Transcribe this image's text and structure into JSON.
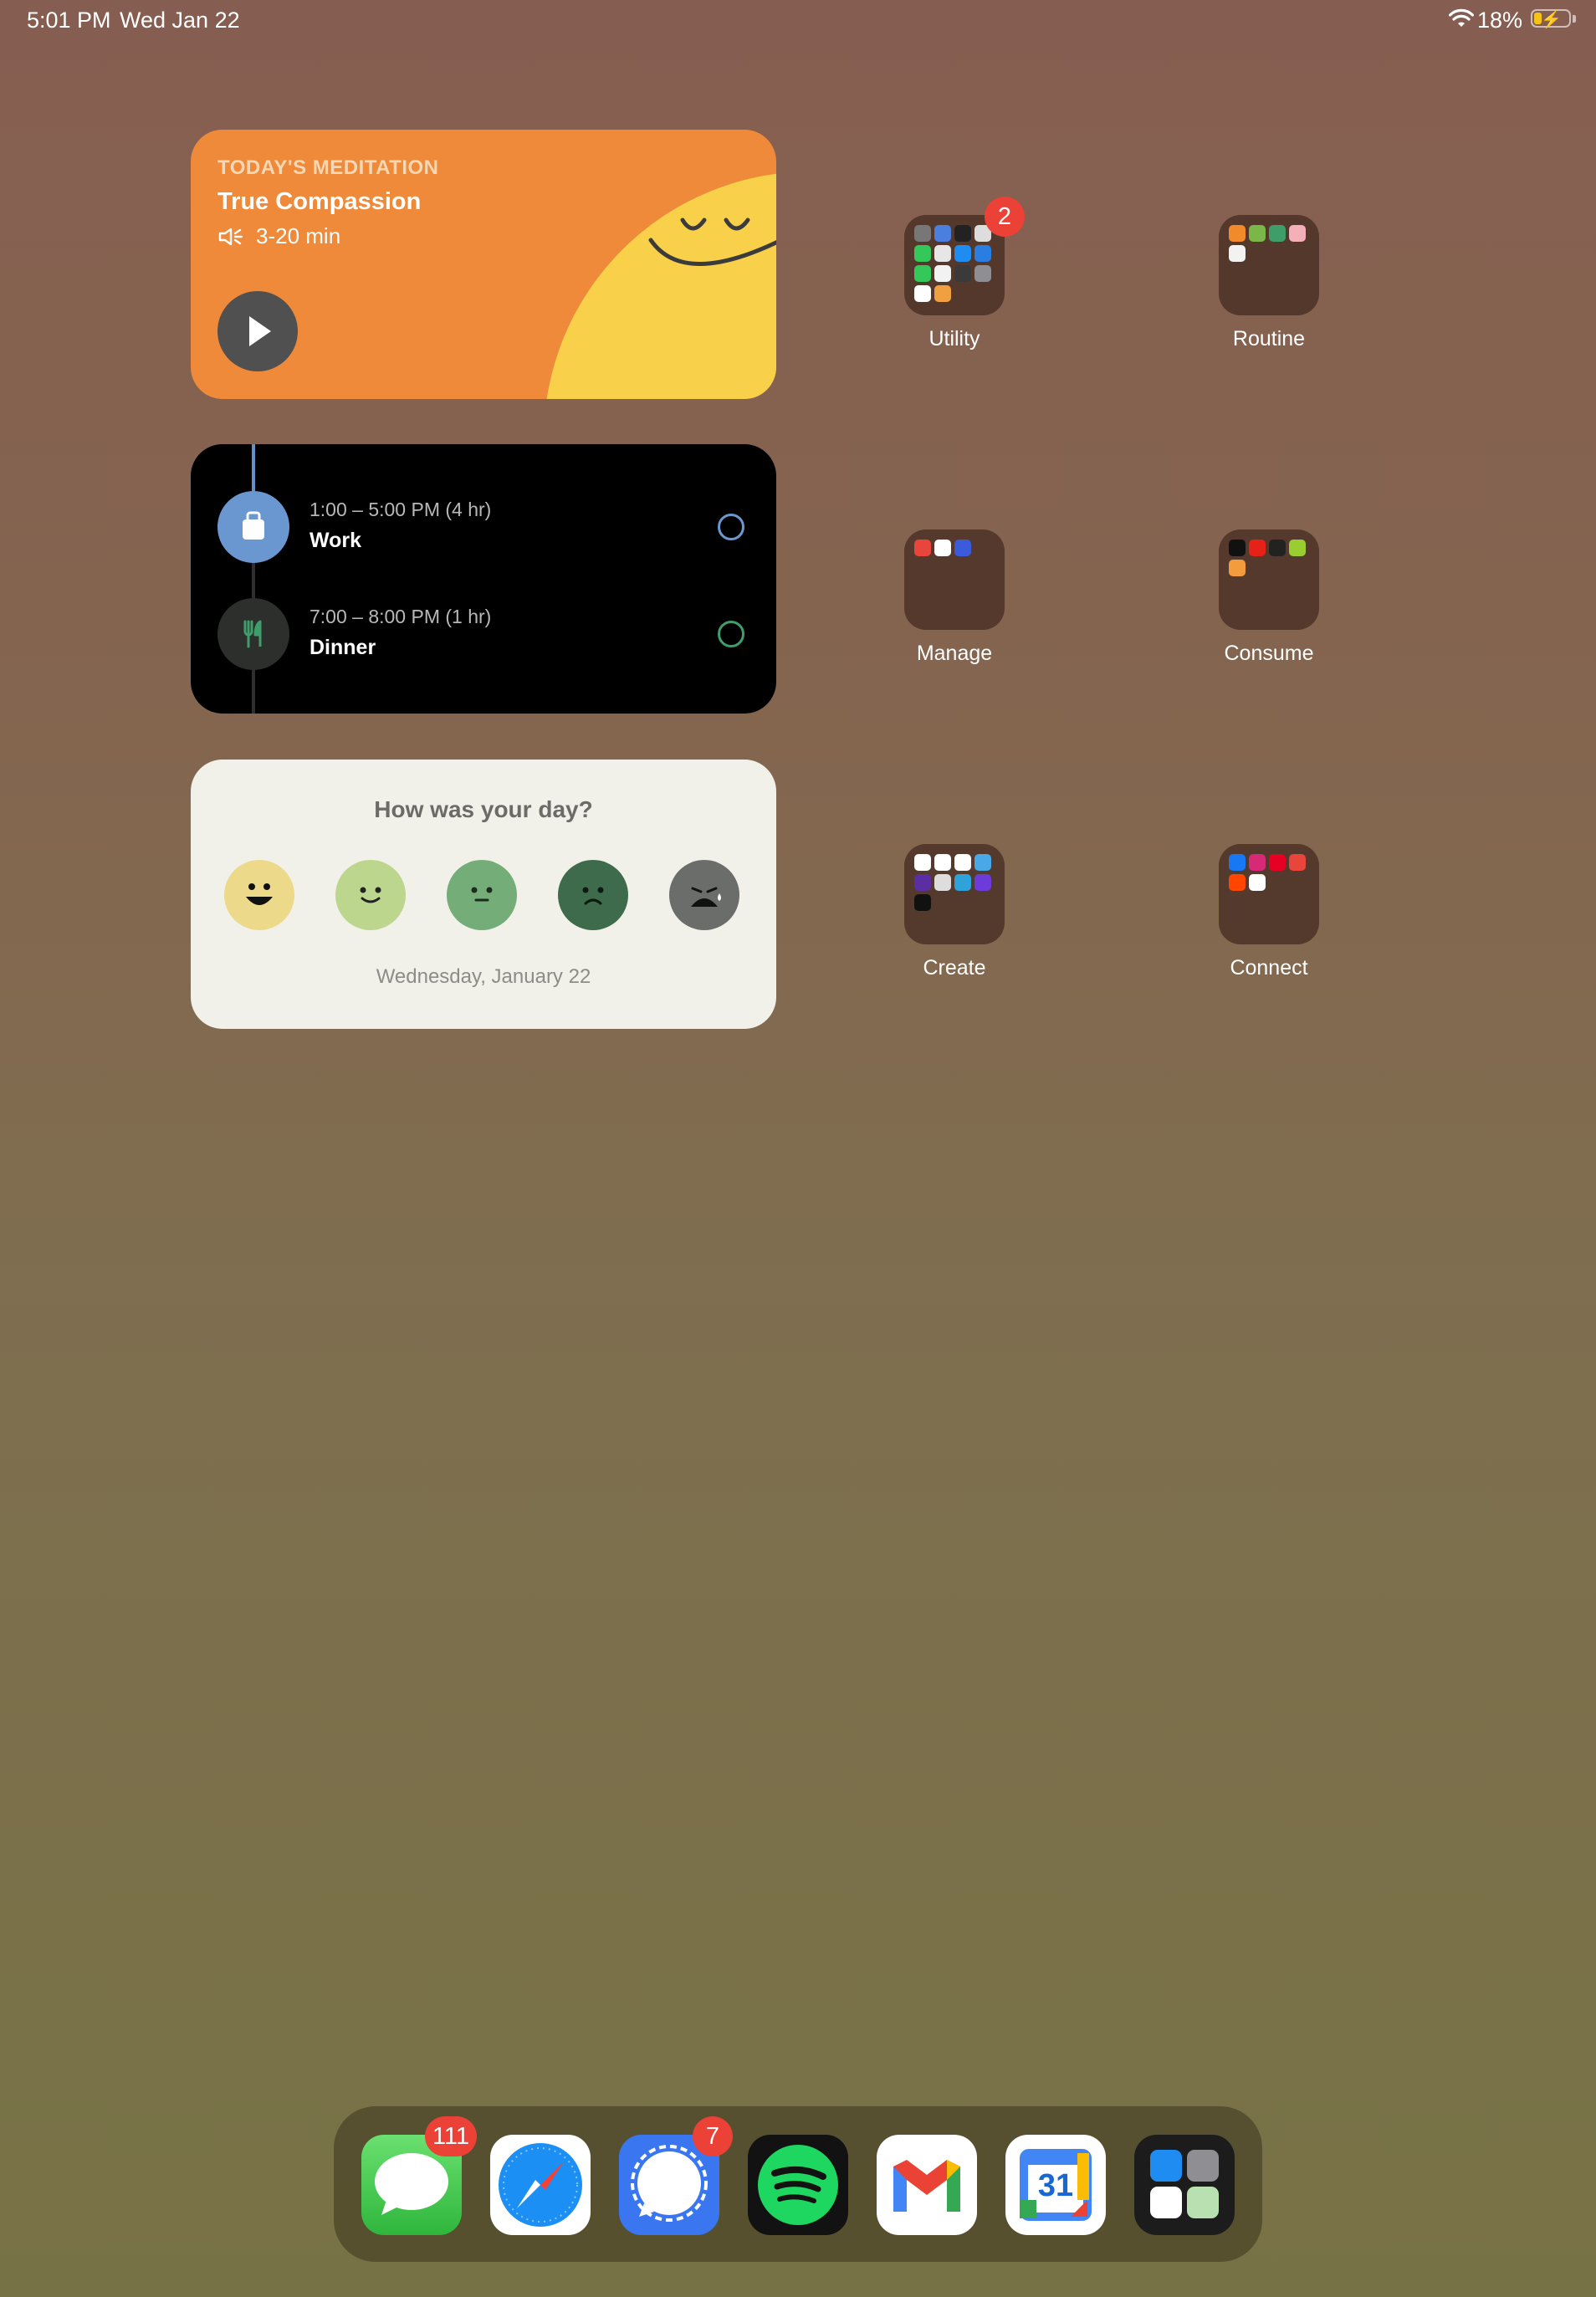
{
  "status_bar": {
    "time": "5:01 PM",
    "date": "Wed Jan 22",
    "battery_percent": "18%",
    "battery_level": 0.18,
    "charging": true
  },
  "meditation_widget": {
    "label": "TODAY'S MEDITATION",
    "title": "True Compassion",
    "duration": "3-20 min",
    "icons": [
      "speaker-icon",
      "play-icon"
    ]
  },
  "planner_widget": {
    "items": [
      {
        "time": "1:00 – 5:00 PM (4 hr)",
        "name": "Work",
        "icon": "briefcase-icon",
        "color": "#6a97cf"
      },
      {
        "time": "7:00 – 8:00 PM (1 hr)",
        "name": "Dinner",
        "icon": "fork-knife-icon",
        "color": "#3f9d6a"
      }
    ]
  },
  "mood_widget": {
    "question": "How was your day?",
    "date": "Wednesday, January 22",
    "faces": [
      {
        "mood": "great",
        "color": "#ecd98a"
      },
      {
        "mood": "good",
        "color": "#bcd68e"
      },
      {
        "mood": "okay",
        "color": "#74ad78"
      },
      {
        "mood": "bad",
        "color": "#3e6b4c"
      },
      {
        "mood": "awful",
        "color": "#6b6d6b"
      }
    ]
  },
  "folders": [
    {
      "label": "Utility",
      "badge": "2"
    },
    {
      "label": "Routine"
    },
    {
      "label": "Manage"
    },
    {
      "label": "Consume"
    },
    {
      "label": "Create"
    },
    {
      "label": "Connect"
    }
  ],
  "dock": {
    "apps": [
      {
        "name": "Messages",
        "badge": "111"
      },
      {
        "name": "Safari"
      },
      {
        "name": "Signal",
        "badge": "7"
      },
      {
        "name": "Spotify"
      },
      {
        "name": "Gmail"
      },
      {
        "name": "Google Calendar",
        "text": "31"
      },
      {
        "name": "App Library"
      }
    ]
  }
}
